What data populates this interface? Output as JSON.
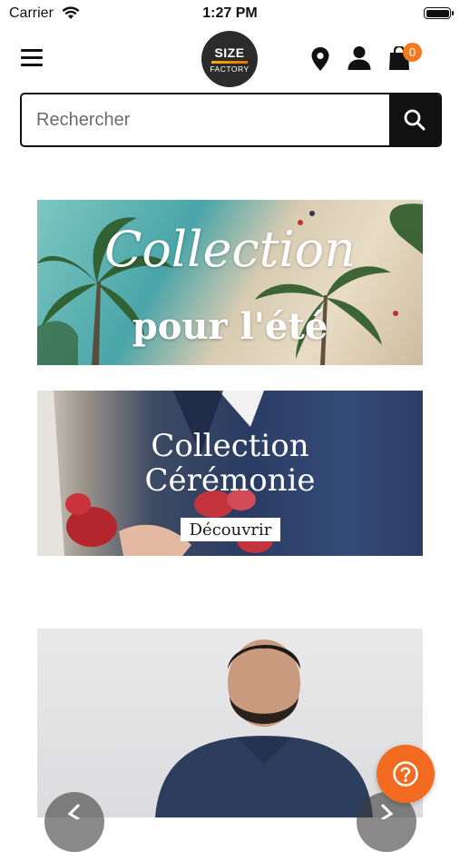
{
  "status_bar": {
    "carrier": "Carrier",
    "time": "1:27 PM"
  },
  "header": {
    "logo_line1": "SIZE",
    "logo_line2": "FACTORY",
    "cart_count": "0",
    "icons": [
      "menu-icon",
      "location-pin-icon",
      "user-icon",
      "shopping-bag-icon"
    ]
  },
  "search": {
    "placeholder": "Rechercher",
    "value": ""
  },
  "banners": [
    {
      "title": "Collection",
      "subtitle": "pour l'été"
    },
    {
      "title_line1": "Collection",
      "title_line2": "Cérémonie",
      "button_label": "Découvrir"
    }
  ],
  "floating": {
    "help_icon": "question-icon",
    "carousel_icons": [
      "chevron-left-icon",
      "chevron-right-icon"
    ]
  },
  "colors": {
    "accent": "#f36b21",
    "dark": "#111111",
    "badge": "#f47a20"
  }
}
